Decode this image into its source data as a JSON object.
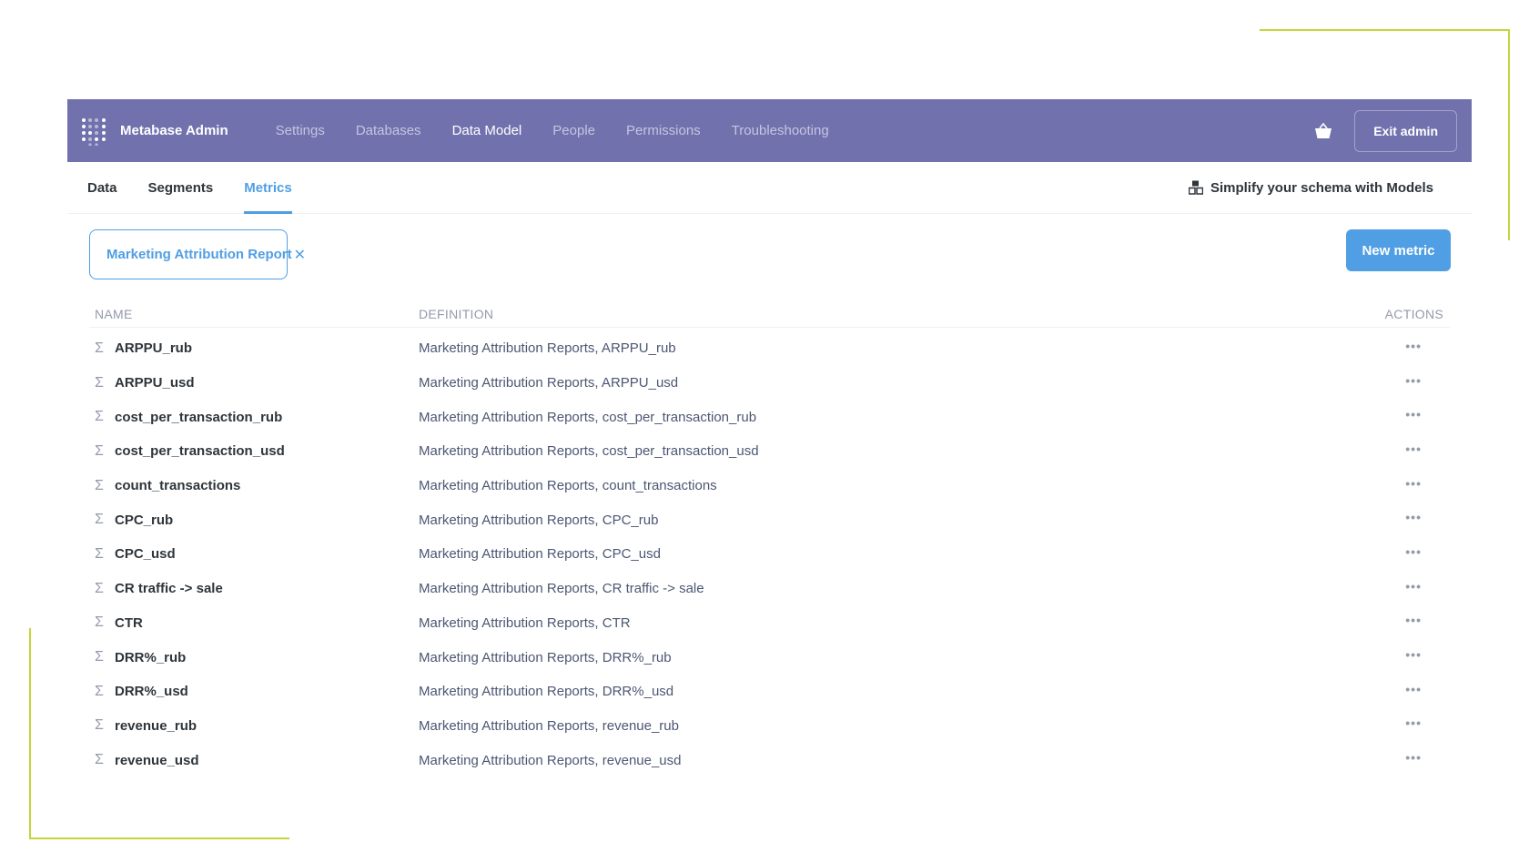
{
  "admin_nav": {
    "brand": "Metabase Admin",
    "items": [
      {
        "label": "Settings"
      },
      {
        "label": "Databases"
      },
      {
        "label": "Data Model"
      },
      {
        "label": "People"
      },
      {
        "label": "Permissions"
      },
      {
        "label": "Troubleshooting"
      }
    ],
    "active_item": "Data Model",
    "exit_label": "Exit admin"
  },
  "subnav": {
    "tabs": [
      {
        "label": "Data"
      },
      {
        "label": "Segments"
      },
      {
        "label": "Metrics"
      }
    ],
    "active_tab": "Metrics",
    "models_link": "Simplify your schema with Models"
  },
  "filter": {
    "label": "Marketing Attribution Report",
    "clear_glyph": "✕"
  },
  "new_metric_label": "New metric",
  "table": {
    "headers": {
      "name": "NAME",
      "definition": "DEFINITION",
      "actions": "ACTIONS"
    },
    "rows": [
      {
        "name": "ARPPU_rub",
        "definition": "Marketing Attribution Reports, ARPPU_rub"
      },
      {
        "name": "ARPPU_usd",
        "definition": "Marketing Attribution Reports, ARPPU_usd"
      },
      {
        "name": "cost_per_transaction_rub",
        "definition": "Marketing Attribution Reports, cost_per_transaction_rub"
      },
      {
        "name": "cost_per_transaction_usd",
        "definition": "Marketing Attribution Reports, cost_per_transaction_usd"
      },
      {
        "name": "count_transactions",
        "definition": "Marketing Attribution Reports, count_transactions"
      },
      {
        "name": "CPC_rub",
        "definition": "Marketing Attribution Reports, CPC_rub"
      },
      {
        "name": "CPC_usd",
        "definition": "Marketing Attribution Reports, CPC_usd"
      },
      {
        "name": "CR traffic -> sale",
        "definition": "Marketing Attribution Reports, CR traffic -> sale"
      },
      {
        "name": "CTR",
        "definition": "Marketing Attribution Reports, CTR"
      },
      {
        "name": "DRR%_rub",
        "definition": "Marketing Attribution Reports, DRR%_rub"
      },
      {
        "name": "DRR%_usd",
        "definition": "Marketing Attribution Reports, DRR%_usd"
      },
      {
        "name": "revenue_rub",
        "definition": "Marketing Attribution Reports, revenue_rub"
      },
      {
        "name": "revenue_usd",
        "definition": "Marketing Attribution Reports, revenue_usd"
      }
    ],
    "row_icon": "Σ",
    "actions_glyph": "•••"
  },
  "icons": {
    "logo": "metabase-logo-icon",
    "cart": "basket-icon",
    "models": "model-icon",
    "metric": "sigma-icon",
    "row_actions": "ellipsis-icon"
  },
  "colors": {
    "admin_nav_bg": "#7172ad",
    "accent": "#509ee3",
    "decor_line": "#c5d53b"
  }
}
